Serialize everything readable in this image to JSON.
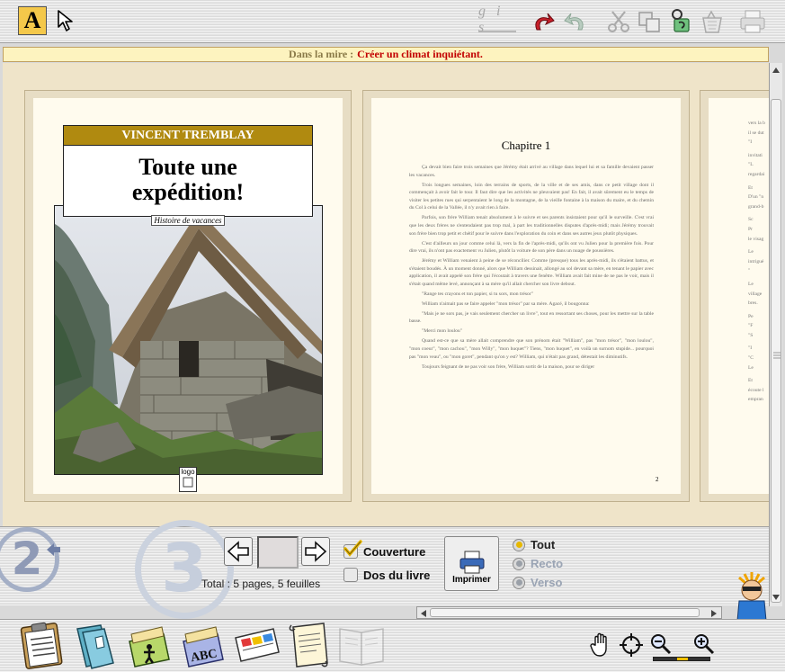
{
  "toolbar": {
    "gis_label": "g i s",
    "icons": [
      "text-tool-icon",
      "pointer-icon",
      "gis-format-icon",
      "undo-icon",
      "redo-icon",
      "scissors-icon",
      "copy-icon",
      "paste-icon",
      "trash-icon",
      "printer-icon"
    ],
    "text_tool_label": "A"
  },
  "info_bar": {
    "label": "Dans la mire :",
    "value": "Créer un climat inquiétant."
  },
  "cover": {
    "author": "VINCENT TREMBLAY",
    "title_line1": "Toute une",
    "title_line2": "expédition!",
    "subtitle": "Histoire de vacances",
    "logo_label": "logo"
  },
  "chapter": {
    "heading": "Chapitre 1",
    "page_number": "2",
    "paragraphs": [
      "Ça devait bien faire trois semaines que Jérémy était arrivé au village dans lequel lui et sa famille devaient passer les vacances.",
      "Trois longues semaines, loin des terrains de sports, de la ville et de ses amis, dans ce petit village dont il commençait à avoir fait le tour. Il faut dire que les activités ne pleuvaient pas! En fait, il avait sûrement eu le temps de visiter les petites rues qui serpentaient le long de la montagne, de la vieille fontaine à la maison du maire, et du chemin du Col à celui de la Vallée, il n'y avait rien à faire.",
      "Parfois, son frère William tenait absolument à le suivre et ses parents insistaient pour qu'il le surveille. C'est vrai que les deux frères ne s'entendaient pas trop mal, à part les traditionnelles disputes d'après-midi; mais Jérémy trouvait son frère bien trop petit et chétif pour le suivre dans l'exploration du coin et dans ses autres jeux plutôt physiques.",
      "C'est d'ailleurs un jour comme celui là, vers la fin de l'après-midi, qu'ils ont vu Julien pour la première fois. Pour dire vrai, ils n'ont pas exactement vu Julien, plutôt la voiture de son père dans un nuage de poussières.",
      "Jérémy et William venaient à peine de se réconcilier. Comme (presque) tous les après-midi, ils s'étaient battus, et s'étaient boudés. À un moment donné, alors que William dessinait, allongé au sol devant sa mère, en tenant le papier avec application, il avait appelé son frère qui l'écoutait à travers une fenêtre. William avait fait mine de ne pas le voir, mais il s'était quand même levé, annonçant à sa mère qu'il allait chercher son livre debout.",
      "\"Range tes crayons et ton papier, si tu sors, mon trésor\"",
      "William n'aimait pas se faire appeler \"mon trésor\" par sa mère. Agacé, il bougonna:",
      "\"Mais je ne sors pas, je vais seulement chercher un livre\", tout en ressortant ses choses, pour les mettre sur la table basse.",
      "\"Merci mon loulou\"",
      "Quand est-ce que sa mère allait comprendre que son prénom était \"William\", pas \"mon trésor\", \"mon loulou\", \"mon coeur\", \"mon cachou\", \"mon Willy\", \"mon huquet\"? Tiens, \"mon huquet\", en voilà un surnom stupide... pourquoi pas \"mon veau\", ou \"mon goret\", pendant qu'on y est? William, qui n'était pas grand, détestait les diminutifs.",
      "Toujours feignant de ne pas voir son frère, William sortit de la maison, pour se diriger"
    ]
  },
  "third_page": {
    "lines": [
      "vers la b",
      "il se dut",
      "\"I",
      "invitati",
      "\"L",
      "regardai",
      "Et",
      "D'un \"n",
      "grand-b",
      "Sc",
      "Pr",
      "le visag",
      "Le",
      "intrigué",
      "\"",
      "Le",
      "village",
      "bres.",
      "Pe",
      "\"F",
      "\"S",
      "\"I",
      "\"C",
      "Le",
      "Et",
      "écoute l",
      "empran"
    ]
  },
  "bottom": {
    "step_previous": "2",
    "step_current": "3",
    "total_label": "Total : 5 pages, 5 feuilles",
    "cover_checkbox": "Couverture",
    "cover_checked": true,
    "spine_checkbox": "Dos du livre",
    "spine_checked": false,
    "print_button": "Imprimer",
    "radio_all": "Tout",
    "radio_recto": "Recto",
    "radio_verso": "Verso",
    "selected_radio": "Tout"
  },
  "dock": {
    "items": [
      "clipboard-icon",
      "folders-icon",
      "character-cards-icon",
      "abc-cards-icon",
      "color-cards-icon",
      "scroll-icon",
      "book-icon"
    ],
    "tools": [
      "hand-icon",
      "crosshair-icon",
      "zoom-out-icon",
      "zoom-in-icon"
    ],
    "zoom_level": 0.5
  },
  "colors": {
    "author_band": "#b08a10",
    "info_bar_bg": "#fdf3bf",
    "info_value": "#c20000",
    "text_tool": "#f4c84a"
  }
}
